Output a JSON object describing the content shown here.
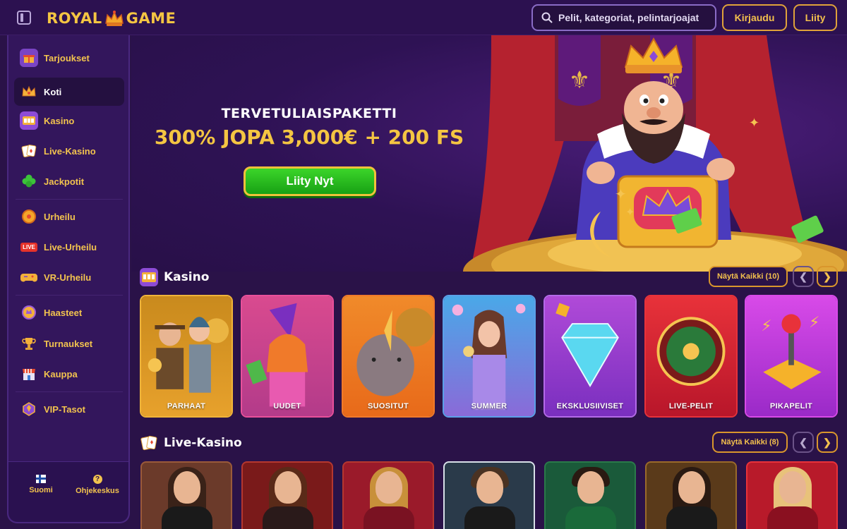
{
  "header": {
    "logo_left": "ROYAL",
    "logo_right": "GAME",
    "search_placeholder": "Pelit, kategoriat, pelintarjoajat",
    "login_label": "Kirjaudu",
    "join_label": "Liity"
  },
  "sidebar": {
    "items": [
      {
        "label": "Tarjoukset",
        "icon": "gift-icon"
      },
      {
        "label": "Koti",
        "icon": "crown-icon"
      },
      {
        "label": "Kasino",
        "icon": "slot-machine-icon"
      },
      {
        "label": "Live-Kasino",
        "icon": "cards-icon"
      },
      {
        "label": "Jackpotit",
        "icon": "clover-icon"
      },
      {
        "label": "Urheilu",
        "icon": "ball-icon"
      },
      {
        "label": "Live-Urheilu",
        "icon": "live-badge-icon"
      },
      {
        "label": "VR-Urheilu",
        "icon": "gamepad-icon"
      },
      {
        "label": "Haasteet",
        "icon": "medal-icon"
      },
      {
        "label": "Turnaukset",
        "icon": "trophy-icon"
      },
      {
        "label": "Kauppa",
        "icon": "shop-icon"
      },
      {
        "label": "VIP-Tasot",
        "icon": "vip-icon"
      }
    ],
    "active": "Koti",
    "live_badge": "LIVE",
    "language_label": "Suomi",
    "help_label": "Ohjekeskus"
  },
  "hero": {
    "subtitle": "TERVETULIAISPAKETTI",
    "title": "300% JOPA 3,000€ + 200 FS",
    "cta_label": "Liity Nyt"
  },
  "casino_section": {
    "title": "Kasino",
    "show_all": "Näytä Kaikki (10)",
    "cards": [
      "PARHAAT",
      "UUDET",
      "SUOSITUT",
      "SUMMER",
      "EKSKLUSIIVISET",
      "LIVE-PELIT",
      "PIKAPELIT"
    ]
  },
  "live_section": {
    "title": "Live-Kasino",
    "show_all": "Näytä Kaikki (8)"
  },
  "colors": {
    "accent_gold": "#f3c04d",
    "background": "#2a1248",
    "cta_green": "#2fc21f"
  }
}
